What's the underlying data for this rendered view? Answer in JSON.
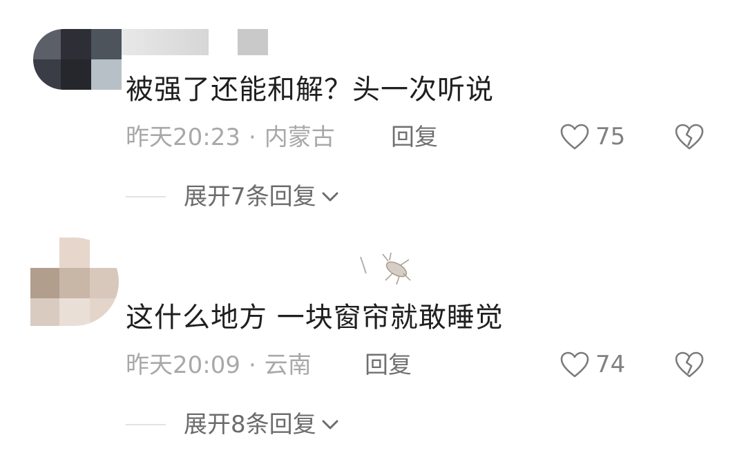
{
  "comments": [
    {
      "username": "",
      "content": "被强了还能和解？头一次听说",
      "time": "昨天20:23",
      "separator": "·",
      "location": "内蒙古",
      "reply_label": "回复",
      "likes": "75",
      "expand_label": "展开7条回复"
    },
    {
      "username": "",
      "content": "这什么地方  一块窗帘就敢睡觉",
      "time": "昨天20:09",
      "separator": "·",
      "location": "云南",
      "reply_label": "回复",
      "likes": "74",
      "expand_label": "展开8条回复"
    }
  ],
  "icons": {
    "like": "heart-outline-icon",
    "dislike": "broken-heart-icon",
    "expand": "chevron-down-icon"
  },
  "colors": {
    "text_primary": "#1f1f1f",
    "text_secondary": "#a8a8a8",
    "icon_gray": "#7a7a7a"
  }
}
